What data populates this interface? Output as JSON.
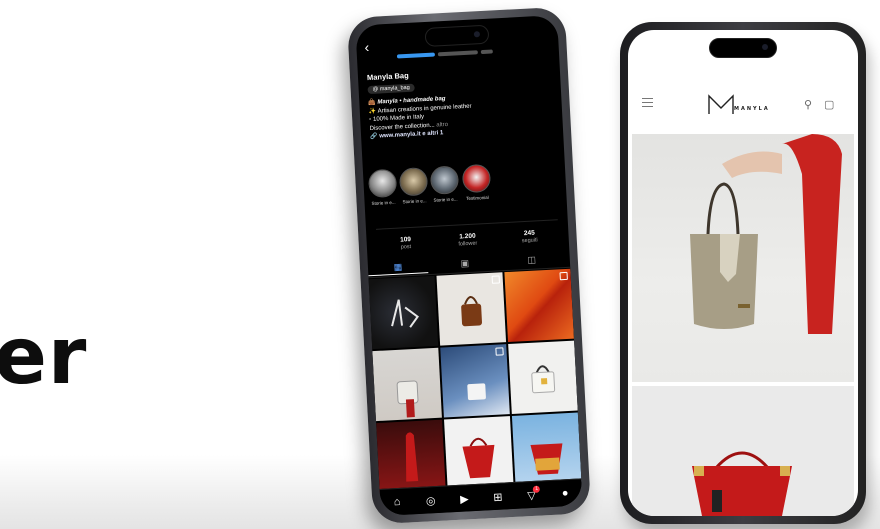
{
  "banner": {
    "word": "er"
  },
  "instagram": {
    "profile_name": "Manyla Bag",
    "handle": "manyla_bag",
    "bio_line1": "Manyla • handmade bag",
    "bio_line2": "Artisan creations in genuine leather",
    "bio_line3": "100% Made in Italy",
    "bio_line4": "Discover the collection...",
    "bio_more": "altro",
    "bio_link": "www.manyla.it e altri 1",
    "highlights": [
      "Storie in e...",
      "Storie in e...",
      "Storie in e...",
      "Testimonial"
    ],
    "stats": [
      {
        "value": "109",
        "label": "post"
      },
      {
        "value": "1.200",
        "label": "follower"
      },
      {
        "value": "245",
        "label": "seguiti"
      }
    ],
    "notification_count": "1"
  },
  "shop": {
    "brand": "MANYLA"
  },
  "colors": {
    "accent_red": "#c41a1a",
    "instagram_blue": "#5ea1ff",
    "bag_beige": "#a79e86"
  }
}
